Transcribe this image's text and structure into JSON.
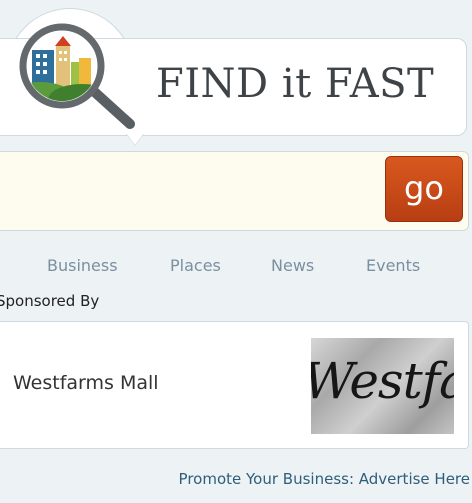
{
  "brand": {
    "title": "FIND it FAST",
    "logo_icon": "magnifier-city-icon"
  },
  "search": {
    "value": "",
    "placeholder": "",
    "go_label": "go"
  },
  "tabs": [
    {
      "label": "Business"
    },
    {
      "label": "Places"
    },
    {
      "label": "News"
    },
    {
      "label": "Events"
    }
  ],
  "sponsor": {
    "heading": "Sponsored By",
    "name": "Westfarms Mall",
    "logo_text": "Westfarms"
  },
  "footer": {
    "promote_link": "Promote Your Business: Advertise Here"
  },
  "colors": {
    "accent": "#c9491a",
    "tab_text": "#7b8fa0",
    "link": "#2e5f7a",
    "search_bg": "#fdfcef"
  }
}
